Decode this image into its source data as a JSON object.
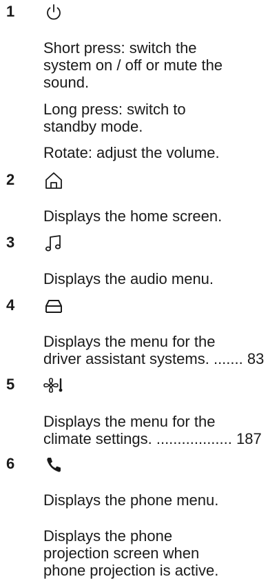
{
  "entries": [
    {
      "number": "1",
      "icon": "power-icon",
      "paragraphs": [
        [
          "Short press: switch the",
          "system on / off or mute the",
          "sound."
        ],
        [
          "Long press: switch to",
          "standby mode."
        ],
        [
          "Rotate: adjust the volume."
        ]
      ]
    },
    {
      "number": "2",
      "icon": "home-icon",
      "paragraphs": [
        [
          "Displays the home screen."
        ]
      ]
    },
    {
      "number": "3",
      "icon": "music-note-icon",
      "paragraphs": [
        [
          "Displays the audio menu."
        ]
      ]
    },
    {
      "number": "4",
      "icon": "car-icon",
      "paragraphs": [
        [
          "Displays the menu for the",
          "driver assistant systems. ....... 83"
        ]
      ]
    },
    {
      "number": "5",
      "icon": "climate-fan-icon",
      "paragraphs": [
        [
          "Displays the menu for the",
          "climate settings. .................. 187"
        ]
      ]
    },
    {
      "number": "6",
      "icon": "phone-icon",
      "paragraphs": [
        [
          "Displays the phone menu."
        ],
        [
          "Displays the phone",
          "projection screen when",
          "phone projection is active."
        ]
      ]
    }
  ]
}
